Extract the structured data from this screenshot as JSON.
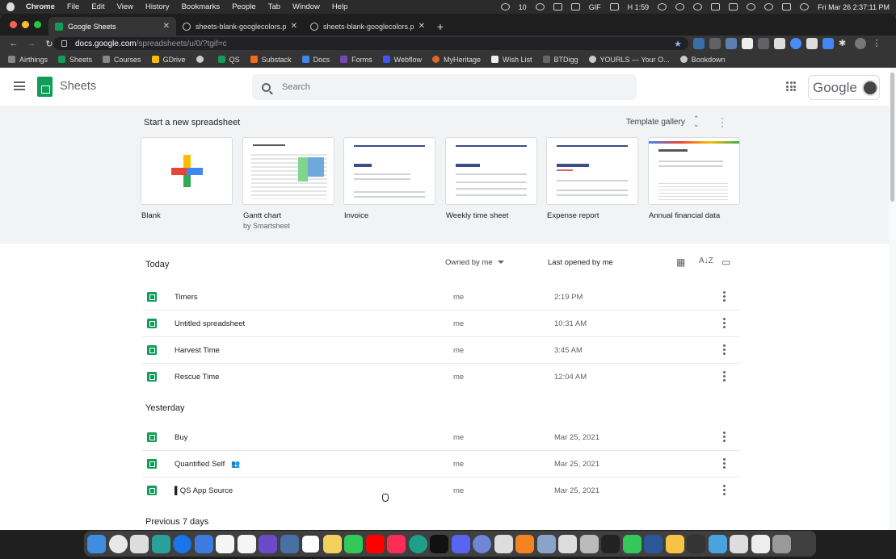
{
  "menubar": {
    "app": "Chrome",
    "items": [
      "File",
      "Edit",
      "View",
      "History",
      "Bookmarks",
      "People",
      "Tab",
      "Window",
      "Help"
    ],
    "tray": {
      "counter": "10",
      "gif": "GIF",
      "timer": "H 1:59",
      "clock": "Fri Mar 26  2:37:11 PM"
    }
  },
  "browser": {
    "tabs": [
      {
        "title": "Google Sheets",
        "active": true
      },
      {
        "title": "sheets-blank-googlecolors.pn",
        "active": false
      },
      {
        "title": "sheets-blank-googlecolors.pn",
        "active": false
      }
    ],
    "new_tab": "+",
    "url_host": "docs.google.com",
    "url_path": "/spreadsheets/u/0/?tgif=c",
    "bookmarks": [
      "Airthings",
      "Sheets",
      "Courses",
      "GDrive",
      "QS",
      "Substack",
      "Docs",
      "Forms",
      "Webflow",
      "MyHeritage",
      "Wish List",
      "BTDigg",
      "YOURLS — Your O...",
      "Bookdown"
    ]
  },
  "app": {
    "title": "Sheets",
    "search_placeholder": "Search",
    "account_wordmark": "Google",
    "colors": {
      "sheets_green": "#0f9d58",
      "blue": "#4285f4",
      "red": "#ea4335",
      "yellow": "#fbbc04",
      "green": "#34a853"
    }
  },
  "templates": {
    "heading": "Start a new spreadsheet",
    "gallery_label": "Template gallery",
    "items": [
      {
        "label": "Blank",
        "sub": ""
      },
      {
        "label": "Gantt chart",
        "sub": "by Smartsheet"
      },
      {
        "label": "Invoice",
        "sub": ""
      },
      {
        "label": "Weekly time sheet",
        "sub": ""
      },
      {
        "label": "Expense report",
        "sub": ""
      },
      {
        "label": "Annual financial data",
        "sub": ""
      }
    ]
  },
  "files": {
    "owned_filter": "Owned by me",
    "sort_label": "Last opened by me",
    "sections": [
      {
        "title": "Today",
        "rows": [
          {
            "name": "Timers",
            "owner": "me",
            "opened": "2:19 PM",
            "shared": false
          },
          {
            "name": "Untitled spreadsheet",
            "owner": "me",
            "opened": "10:31 AM",
            "shared": false
          },
          {
            "name": "Harvest Time",
            "owner": "me",
            "opened": "3:45 AM",
            "shared": false
          },
          {
            "name": "Rescue Time",
            "owner": "me",
            "opened": "12:04 AM",
            "shared": false
          }
        ]
      },
      {
        "title": "Yesterday",
        "rows": [
          {
            "name": "Buy",
            "owner": "me",
            "opened": "Mar 25, 2021",
            "shared": false
          },
          {
            "name": "Quantified Self",
            "owner": "me",
            "opened": "Mar 25, 2021",
            "shared": true
          },
          {
            "name": "▌QS App Source",
            "owner": "me",
            "opened": "Mar 25, 2021",
            "shared": false
          }
        ]
      },
      {
        "title": "Previous 7 days",
        "rows": []
      }
    ]
  }
}
